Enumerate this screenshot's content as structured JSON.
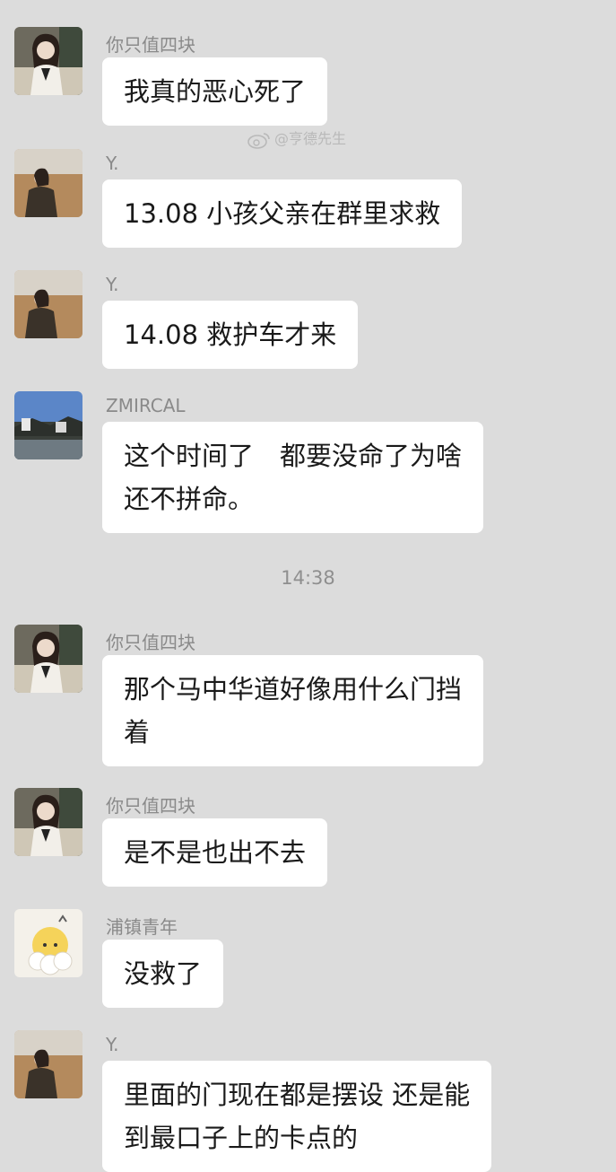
{
  "watermark": {
    "text": "@亨德先生",
    "icon": "weibo-icon"
  },
  "messages": [
    {
      "sender": "你只值四块",
      "text": "我真的恶心死了",
      "avatar": "girl-glasses-avatar"
    },
    {
      "sender": "Y.",
      "text": "13.08 小孩父亲在群里求救",
      "avatar": "girl-field-avatar"
    },
    {
      "sender": "Y.",
      "text": "14.08 救护车才来",
      "avatar": "girl-field-avatar"
    },
    {
      "sender": "ZMIRCAL",
      "line1": "这个时间了　都要没命了为啥",
      "line2": "还不拼命。",
      "avatar": "town-scene-avatar"
    },
    {
      "sender": "你只值四块",
      "line1": "那个马中华道好像用什么门挡",
      "line2": "着",
      "avatar": "girl-glasses-avatar"
    },
    {
      "sender": "你只值四块",
      "text": "是不是也出不去",
      "avatar": "girl-glasses-avatar"
    },
    {
      "sender": "浦镇青年",
      "text": "没救了",
      "avatar": "cartoon-sheep-avatar"
    },
    {
      "sender": "Y.",
      "line1": "里面的门现在都是摆设 还是能",
      "line2": "到最口子上的卡点的",
      "avatar": "girl-field-avatar"
    }
  ],
  "timestamp": "14:38"
}
